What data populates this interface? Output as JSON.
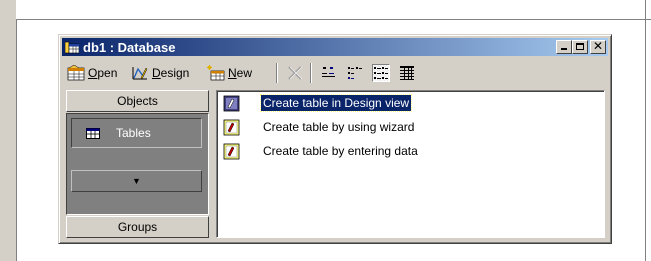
{
  "window": {
    "title": "db1 : Database",
    "close_glyph": "✕"
  },
  "toolbar": {
    "open_prefix": "",
    "open_underline": "O",
    "open_rest": "pen",
    "design_prefix": "",
    "design_underline": "D",
    "design_rest": "esign",
    "new_prefix": "",
    "new_underline": "N",
    "new_rest": "ew",
    "views": [
      "large-icons",
      "small-icons",
      "list",
      "details"
    ],
    "active_view": "list"
  },
  "objects_bar": {
    "header": "Objects",
    "selected_item": "Tables",
    "scroll_glyph": "▼",
    "groups": "Groups"
  },
  "list": {
    "items": [
      {
        "label": "Create table in Design view",
        "selected": true
      },
      {
        "label": "Create table by using wizard",
        "selected": false
      },
      {
        "label": "Create table by entering data",
        "selected": false
      }
    ]
  },
  "colors": {
    "title_active": "#0a246a",
    "title_gradient_end": "#a6caf0",
    "face": "#d4d0c8",
    "selection": "#0a246a"
  }
}
